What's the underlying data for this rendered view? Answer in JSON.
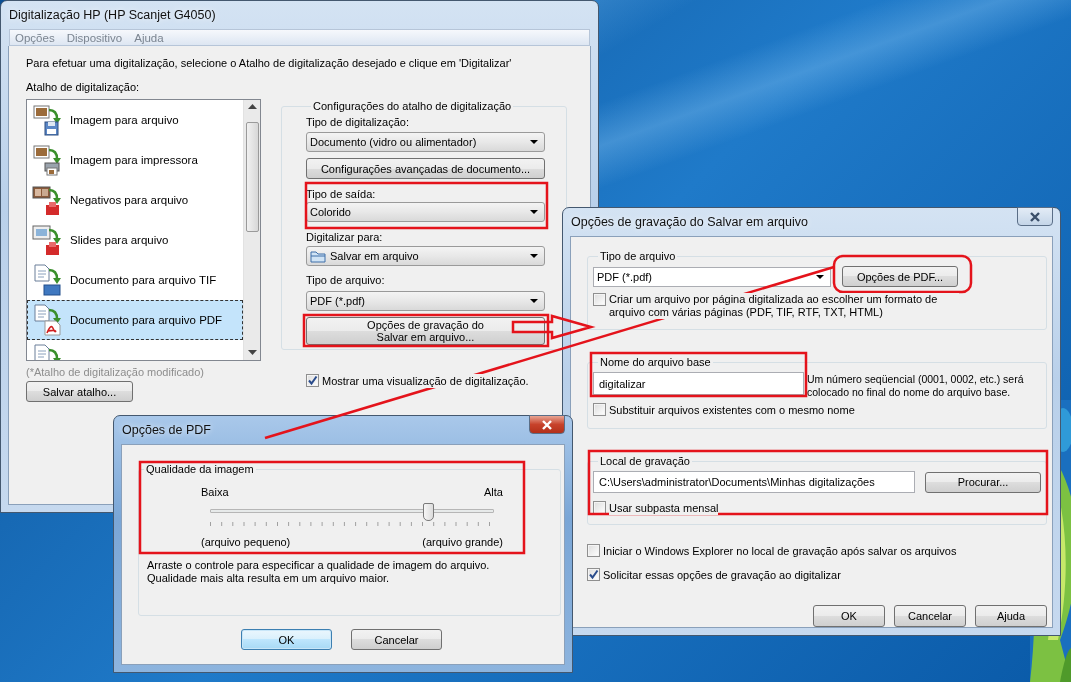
{
  "main_window": {
    "title": "Digitalização HP (HP Scanjet G4050)",
    "active": false,
    "menu": [
      "Opções",
      "Dispositivo",
      "Ajuda"
    ],
    "instruction": "Para efetuar uma digitalização, selecione o Atalho de digitalização desejado e clique em 'Digitalizar'",
    "shortcuts_label": "Atalho de digitalização:",
    "shortcuts": [
      {
        "kind": "image-file",
        "label": "Imagem para arquivo",
        "selected": false
      },
      {
        "kind": "image-printer",
        "label": "Imagem para impressora",
        "selected": false
      },
      {
        "kind": "negative-file",
        "label": "Negativos para arquivo",
        "selected": false
      },
      {
        "kind": "slide-file",
        "label": "Slides para arquivo",
        "selected": false
      },
      {
        "kind": "document-tif",
        "label": "Documento para arquivo TIF",
        "selected": false
      },
      {
        "kind": "document-pdf",
        "label": "Documento para arquivo PDF",
        "selected": true
      },
      {
        "kind": "document-pdf",
        "selected": false
      }
    ],
    "modified_note": "(*Atalho de digitalização modificado)",
    "save_shortcut_button": "Salvar atalho...",
    "settings": {
      "title": "Configurações do atalho de digitalização",
      "scan_type": {
        "label": "Tipo de digitalização:",
        "value": "Documento (vidro ou alimentador)"
      },
      "advanced_button": "Configurações avançadas de documento...",
      "output_type": {
        "label": "Tipo de saída:",
        "value": "Colorido"
      },
      "scan_to": {
        "label": "Digitalizar para:",
        "value": "Salvar em arquivo"
      },
      "file_type": {
        "label": "Tipo de arquivo:",
        "value": "PDF (*.pdf)"
      },
      "save_options_button": [
        "Opções de gravação do",
        "Salvar em arquivo..."
      ]
    },
    "preview": {
      "label": "Mostrar uma visualização de digitalização.",
      "checked": true
    }
  },
  "save_dialog": {
    "title": "Opções de gravação do Salvar em arquivo",
    "active": false,
    "file_type": {
      "title": "Tipo de arquivo",
      "value": "PDF (*.pdf)",
      "pdf_options_button": "Opções de PDF...",
      "one_file_per_page": {
        "label": "Criar um arquivo por página digitalizada ao escolher um formato de arquivo com várias páginas (PDF, TIF, RTF, TXT, HTML)",
        "checked": false
      }
    },
    "base_name": {
      "title": "Nome do arquivo base",
      "value": "digitalizar",
      "hint": "Um número seqüencial (0001, 0002, etc.) será colocado no final do nome do arquivo base.",
      "overwrite": {
        "label": "Substituir arquivos existentes com o mesmo nome",
        "checked": false
      }
    },
    "location": {
      "title": "Local de gravação",
      "value": "C:\\Users\\administrator\\Documents\\Minhas digitalizações",
      "browse_button": "Procurar...",
      "monthly_subfolder": {
        "label": "Usar subpasta mensal",
        "checked": false
      }
    },
    "options": [
      {
        "label": "Iniciar o Windows Explorer no local de gravação após salvar os arquivos",
        "checked": false
      },
      {
        "label": "Solicitar essas opções de gravação ao digitalizar",
        "checked": true
      }
    ],
    "buttons": [
      "OK",
      "Cancelar",
      "Ajuda"
    ]
  },
  "pdf_dialog": {
    "title": "Opções de PDF",
    "active": true,
    "quality": {
      "title": "Qualidade da imagem",
      "low": "Baixa",
      "high": "Alta",
      "level": 0.77,
      "low_note": "(arquivo pequeno)",
      "high_note": "(arquivo grande)"
    },
    "description": "Arraste o controle para especificar a qualidade de imagem do arquivo. Qualidade mais alta resulta em um arquivo maior.",
    "buttons": [
      {
        "label": "OK",
        "default": true
      },
      {
        "label": "Cancelar",
        "default": false
      }
    ]
  }
}
